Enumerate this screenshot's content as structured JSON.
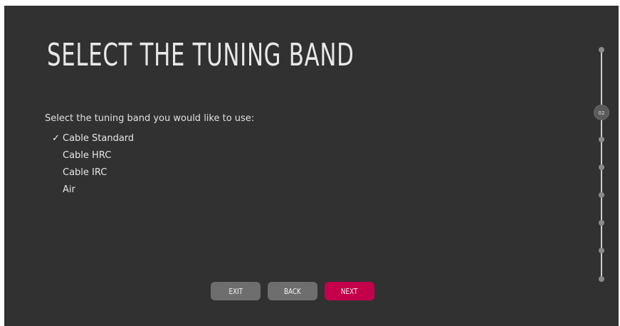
{
  "title": "SELECT THE TUNING BAND",
  "prompt": "Select the tuning band you would like to use:",
  "options": [
    {
      "label": "Cable Standard",
      "selected": true
    },
    {
      "label": "Cable HRC",
      "selected": false
    },
    {
      "label": "Cable IRC",
      "selected": false
    },
    {
      "label": "Air",
      "selected": false
    }
  ],
  "check_mark": "✓",
  "buttons": {
    "exit": "EXIT",
    "back": "BACK",
    "next": "NEXT"
  },
  "progress": {
    "current_step_label": "02"
  },
  "colors": {
    "background": "#313131",
    "next_button": "#c4004a",
    "secondary_button": "#6e6e6e"
  }
}
